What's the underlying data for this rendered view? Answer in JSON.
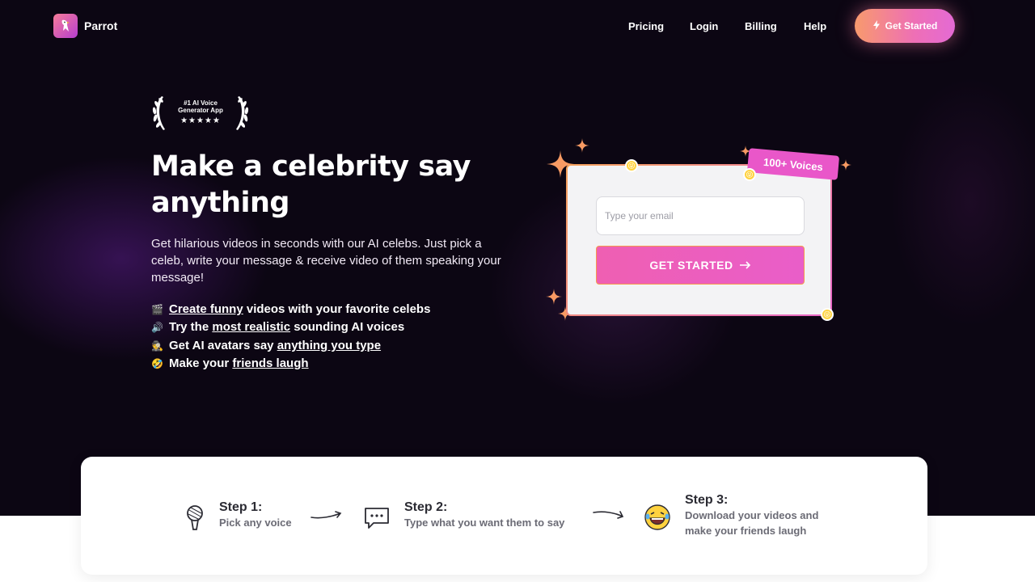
{
  "nav": {
    "brand": "Parrot",
    "links": [
      "Pricing",
      "Login",
      "Billing",
      "Help"
    ],
    "cta_label": "Get Started"
  },
  "badge": {
    "line1": "#1 AI Voice",
    "line2": "Generator App",
    "stars": "★★★★★"
  },
  "hero": {
    "title": "Make a celebrity say anything",
    "subtitle": "Get hilarious videos in seconds with our AI celebs. Just pick a celeb, write your message & receive video of them speaking your message!",
    "features": [
      {
        "icon": "clapper-emoji",
        "parts": [
          "",
          "Create funny",
          " videos with your favorite celebs"
        ]
      },
      {
        "icon": "speaker-emoji",
        "parts": [
          "Try the ",
          "most realistic",
          " sounding AI voices"
        ]
      },
      {
        "icon": "avatar-emoji",
        "parts": [
          "Get AI avatars say ",
          "anything you type",
          ""
        ]
      },
      {
        "icon": "laughing-emoji",
        "parts": [
          "Make your ",
          "friends laugh",
          ""
        ]
      }
    ]
  },
  "form": {
    "email_placeholder": "Type your email",
    "email_value": "",
    "button_label": "GET STARTED",
    "voices_tag": "100+ Voices"
  },
  "steps": [
    {
      "title": "Step 1:",
      "desc": "Pick any voice",
      "icon": "microphone-icon"
    },
    {
      "title": "Step 2:",
      "desc": "Type what you want them to say",
      "icon": "chat-bubble-icon"
    },
    {
      "title": "Step 3:",
      "desc": "Download your videos and make your friends laugh",
      "icon": "laughing-face-icon"
    }
  ],
  "colors": {
    "background": "#0c0613",
    "accent_pink": "#e957c9",
    "accent_orange": "#f89a6d"
  }
}
